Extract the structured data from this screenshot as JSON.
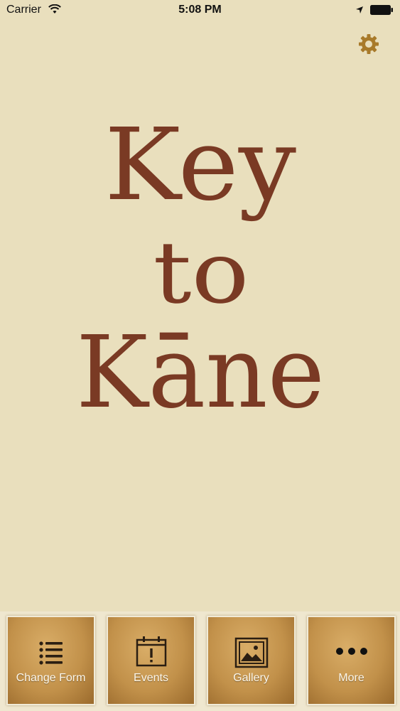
{
  "status_bar": {
    "carrier": "Carrier",
    "time": "5:08 PM"
  },
  "settings": {
    "icon": "gear-icon"
  },
  "logo": {
    "line1": "Key",
    "line2": "to",
    "line3": "Kāne"
  },
  "tabs": [
    {
      "label": "Change Form",
      "icon": "list-icon"
    },
    {
      "label": "Events",
      "icon": "calendar-alert-icon"
    },
    {
      "label": "Gallery",
      "icon": "image-icon"
    },
    {
      "label": "More",
      "icon": "more-dots-icon"
    }
  ],
  "colors": {
    "background": "#e9dfbd",
    "logo": "#7a3a24",
    "accent": "#a87a2a",
    "tab_gold": "#c2914a"
  }
}
